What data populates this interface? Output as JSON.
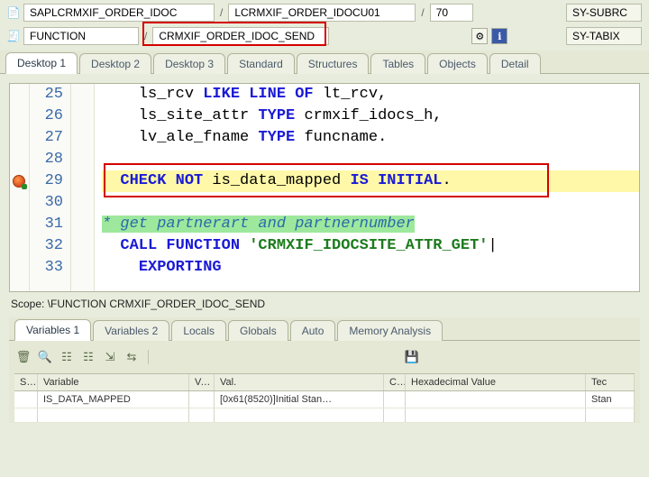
{
  "top": {
    "prog": "SAPLCRMXIF_ORDER_IDOC",
    "incl": "LCRMXIF_ORDER_IDOCU01",
    "line": "70",
    "subrc_label": "SY-SUBRC",
    "type": "FUNCTION",
    "module": "CRMXIF_ORDER_IDOC_SEND",
    "tabix_label": "SY-TABIX"
  },
  "tabs": {
    "main": [
      "Desktop 1",
      "Desktop 2",
      "Desktop 3",
      "Standard",
      "Structures",
      "Tables",
      "Objects",
      "Detail"
    ]
  },
  "code": {
    "lines": [
      {
        "n": "25",
        "html": "    ls_rcv <kw>LIKE LINE OF</kw> lt_rcv,"
      },
      {
        "n": "26",
        "html": "    ls_site_attr <kw>TYPE</kw> crmxif_idocs_h,"
      },
      {
        "n": "27",
        "html": "    lv_ale_fname <kw>TYPE</kw> funcname."
      },
      {
        "n": "28",
        "html": "",
        "bp": false
      },
      {
        "n": "29",
        "html": "  <kw>CHECK NOT</kw> is_data_mapped <kw>IS INITIAL</kw>.",
        "bp": true,
        "hl": true
      },
      {
        "n": "30",
        "html": ""
      },
      {
        "n": "31",
        "html": "<cm>* get partnerart and partnernumber</cm>"
      },
      {
        "n": "32",
        "html": "  <kw>CALL FUNCTION</kw> <st>'CRMXIF_IDOCSITE_ATTR_GET'</st>|",
        "cursor": true
      },
      {
        "n": "33",
        "html": "    <kw>EXPORTING</kw>"
      }
    ]
  },
  "scope": "Scope: \\FUNCTION CRMXIF_ORDER_IDOC_SEND",
  "debugTabs": [
    "Variables 1",
    "Variables 2",
    "Locals",
    "Globals",
    "Auto",
    "Memory Analysis"
  ],
  "varTable": {
    "headers": {
      "s": "S...",
      "var": "Variable",
      "v": "V...",
      "val": "Val.",
      "c": "C...",
      "hex": "Hexadecimal Value",
      "te": "Tec"
    },
    "rows": [
      {
        "s": "",
        "var": "IS_DATA_MAPPED",
        "v": "",
        "val": "[0x61(8520)]Initial Stan…",
        "c": "",
        "hex": "",
        "te": "Stan"
      }
    ]
  },
  "icons": {
    "page": "📄",
    "stack": "🧾",
    "gear": "⚙",
    "info": "ℹ",
    "trash": "🗑",
    "lookup": "🔍",
    "save": "💾",
    "hier": "☷",
    "ins": "⇲",
    "inout": "⇆"
  }
}
